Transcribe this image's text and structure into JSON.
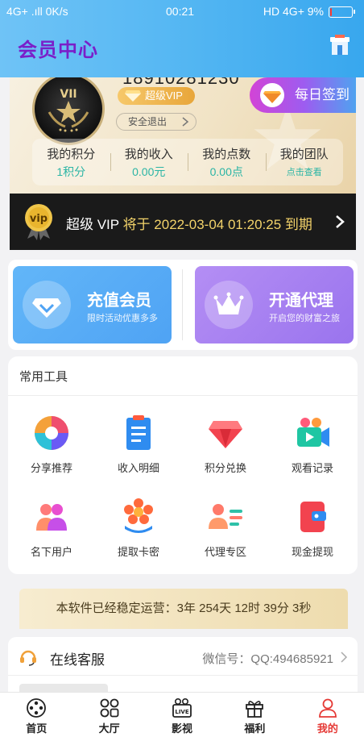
{
  "status_bar": {
    "network": "4G+ .ıll 0K/s",
    "time": "00:21",
    "signal": "HD 4G+",
    "battery": "9%",
    "battery_level": 0.09
  },
  "header": {
    "title": "会员中心",
    "shop_icon": "shop-icon"
  },
  "member": {
    "phone": "18910281230",
    "level_tag": "超级VIP",
    "logout_label": "安全退出",
    "signin_label": "每日签到",
    "stats": [
      {
        "label": "我的积分",
        "value": "1积分"
      },
      {
        "label": "我的收入",
        "value": "0.00元"
      },
      {
        "label": "我的点数",
        "value": "0.00点"
      },
      {
        "label": "我的团队",
        "value": "点击查看"
      }
    ]
  },
  "vip_bar": {
    "level": "超级 VIP",
    "prefix": "将于",
    "date": "2022-03-04 01:20:25",
    "suffix": "到期"
  },
  "promo": {
    "recharge": {
      "title": "充值会员",
      "sub": "限时活动优惠多多"
    },
    "agent": {
      "title": "开通代理",
      "sub": "开启您的财富之旅"
    }
  },
  "tools": {
    "title": "常用工具",
    "items": [
      {
        "label": "分享推荐",
        "icon": "aperture-icon"
      },
      {
        "label": "收入明细",
        "icon": "clipboard-icon"
      },
      {
        "label": "积分兑换",
        "icon": "diamond-icon"
      },
      {
        "label": "观看记录",
        "icon": "video-camera-icon"
      },
      {
        "label": "名下用户",
        "icon": "users-icon"
      },
      {
        "label": "提取卡密",
        "icon": "flower-icon"
      },
      {
        "label": "代理专区",
        "icon": "agent-card-icon"
      },
      {
        "label": "现金提现",
        "icon": "wallet-icon"
      }
    ]
  },
  "uptime": {
    "text": "本软件已经稳定运营：3年 254天 12时 39分 3秒"
  },
  "service": {
    "label": "在线客服",
    "wechat": "微信号：QQ:494685921"
  },
  "tabbar": {
    "items": [
      {
        "label": "首页",
        "active": false
      },
      {
        "label": "大厅",
        "active": false
      },
      {
        "label": "影视",
        "active": false
      },
      {
        "label": "福利",
        "active": false
      },
      {
        "label": "我的",
        "active": true
      }
    ]
  },
  "colors": {
    "accent_purple": "#7a1fc9",
    "header_blue": "#4fb2f2",
    "stat_teal": "#2bb5a5",
    "vip_gold": "#f3d36a",
    "active_red": "#e53935"
  }
}
